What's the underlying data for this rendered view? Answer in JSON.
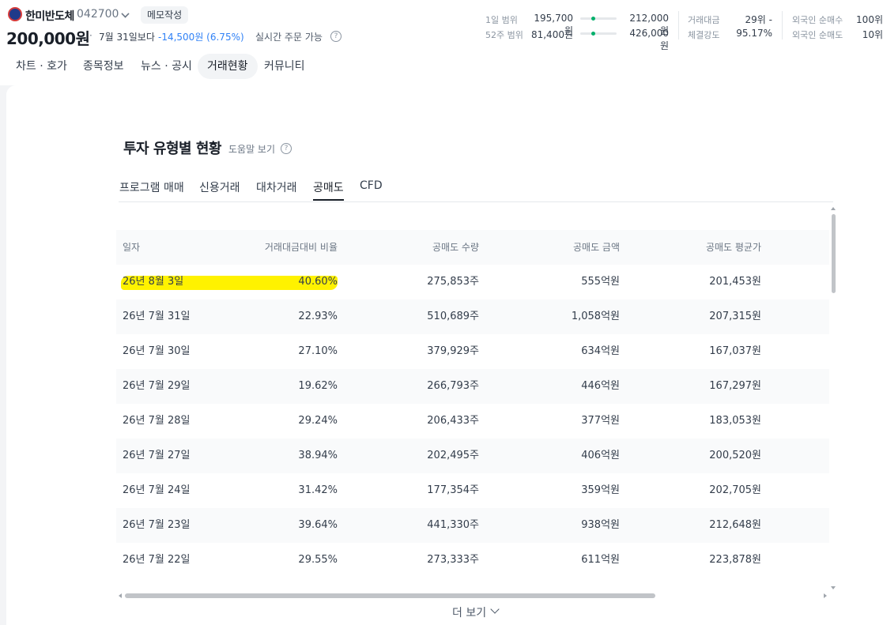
{
  "header": {
    "stock_name": "한미반도체",
    "stock_code": "042700",
    "memo_label": "메모작성",
    "price": "200,000원",
    "price_dot": "·",
    "price_ref": "7월 31일보다",
    "price_change": "-14,500원 (6.75%)",
    "realtime_label": "실시간 주문 가능",
    "help_glyph": "?",
    "stats": {
      "day_range_label": "1일 범위",
      "day_low": "195,700원",
      "day_high": "212,000원",
      "week52_label": "52주 범위",
      "week52_low": "81,400원",
      "week52_high": "426,000원",
      "trade_value_label": "거래대금",
      "trade_value_rank": "29위 -",
      "strength_label": "체결강도",
      "strength_value": "95.17%",
      "foreign_buy_label": "외국인 순매수",
      "foreign_buy_value": "100위",
      "foreign_sell_label": "외국인 순매도",
      "foreign_sell_value": "10위"
    },
    "colors": {
      "down": "#3182f6",
      "range_dot": "#00b06b"
    },
    "day_range_position": 0.3,
    "week52_position": 0.3
  },
  "nav": {
    "tabs": [
      {
        "label": "차트 · 호가",
        "active": false
      },
      {
        "label": "종목정보",
        "active": false
      },
      {
        "label": "뉴스 · 공시",
        "active": false
      },
      {
        "label": "거래현황",
        "active": true
      },
      {
        "label": "커뮤니티",
        "active": false
      }
    ]
  },
  "section": {
    "title": "투자 유형별 현황",
    "help_link": "도움말 보기",
    "sub_tabs": [
      {
        "label": "프로그램 매매",
        "active": false
      },
      {
        "label": "신용거래",
        "active": false
      },
      {
        "label": "대차거래",
        "active": false
      },
      {
        "label": "공매도",
        "active": true
      },
      {
        "label": "CFD",
        "active": false
      }
    ]
  },
  "table": {
    "columns": [
      "일자",
      "거래대금대비 비율",
      "공매도 수량",
      "공매도 금액",
      "공매도 평균가"
    ],
    "rows": [
      [
        "26년 8월 3일",
        "40.60%",
        "275,853주",
        "555억원",
        "201,453원"
      ],
      [
        "26년 7월 31일",
        "22.93%",
        "510,689주",
        "1,058억원",
        "207,315원"
      ],
      [
        "26년 7월 30일",
        "27.10%",
        "379,929주",
        "634억원",
        "167,037원"
      ],
      [
        "26년 7월 29일",
        "19.62%",
        "266,793주",
        "446억원",
        "167,297원"
      ],
      [
        "26년 7월 28일",
        "29.24%",
        "206,433주",
        "377억원",
        "183,053원"
      ],
      [
        "26년 7월 27일",
        "38.94%",
        "202,495주",
        "406억원",
        "200,520원"
      ],
      [
        "26년 7월 24일",
        "31.42%",
        "177,354주",
        "359억원",
        "202,705원"
      ],
      [
        "26년 7월 23일",
        "39.64%",
        "441,330주",
        "938억원",
        "212,648원"
      ],
      [
        "26년 7월 22일",
        "29.55%",
        "273,333주",
        "611억원",
        "223,878원"
      ]
    ],
    "highlighted_row": 0,
    "highlight_color": "#fff200"
  },
  "more_button": "더 보기"
}
